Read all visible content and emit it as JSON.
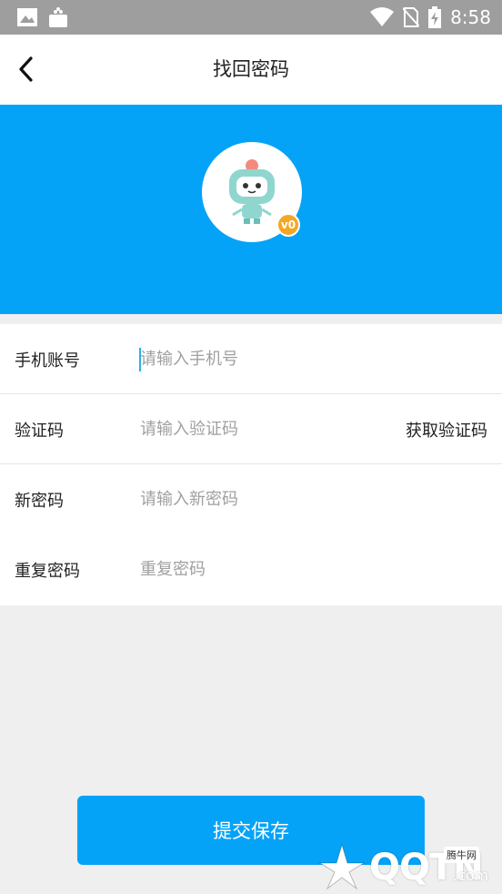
{
  "status_bar": {
    "time": "8:58",
    "icons": [
      "image-icon",
      "shopping-bag-icon",
      "wifi-icon",
      "no-sim-icon",
      "battery-charging-icon"
    ]
  },
  "header": {
    "title": "找回密码",
    "back_icon": "chevron-left-icon"
  },
  "banner": {
    "background": "#05a3f7",
    "version_badge": "v0"
  },
  "form": {
    "phone": {
      "label": "手机账号",
      "placeholder": "请输入手机号",
      "value": ""
    },
    "code": {
      "label": "验证码",
      "placeholder": "请输入验证码",
      "value": "",
      "action_label": "获取验证码"
    },
    "new_password": {
      "label": "新密码",
      "placeholder": "请输入新密码",
      "value": ""
    },
    "repeat_password": {
      "label": "重复密码",
      "placeholder": "重复密码",
      "value": ""
    }
  },
  "submit": {
    "label": "提交保存"
  },
  "watermark": {
    "text": "QQTN",
    "suffix": ".com",
    "badge": "腾牛网"
  },
  "colors": {
    "accent": "#05a3f7",
    "badge": "#f5a623"
  }
}
